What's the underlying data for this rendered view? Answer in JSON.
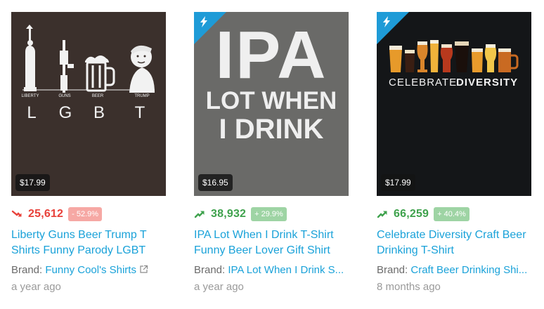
{
  "products": [
    {
      "price": "$17.99",
      "rank": "25,612",
      "change": "- 52.9%",
      "trend": "down",
      "title": "Liberty Guns Beer Trump T Shirts Funny Parody LGBT",
      "brand_label": "Brand:",
      "brand": "Funny Cool's Shirts",
      "age": "a year ago",
      "featured": false,
      "art": {
        "captions": [
          "LIBERTY",
          "GUNS",
          "BEER",
          "TRUMP"
        ],
        "letters": [
          "L",
          "G",
          "B",
          "T"
        ]
      }
    },
    {
      "price": "$16.95",
      "rank": "38,932",
      "change": "+ 29.9%",
      "trend": "up",
      "title": "IPA Lot When I Drink T-Shirt Funny Beer Lover Gift Shirt",
      "brand_label": "Brand:",
      "brand": "IPA Lot When I Drink S...",
      "age": "a year ago",
      "featured": true,
      "art": {
        "line1": "IPA",
        "line2": "LOT WHEN",
        "line3": "I DRINK"
      }
    },
    {
      "price": "$17.99",
      "rank": "66,259",
      "change": "+ 40.4%",
      "trend": "up",
      "title": "Celebrate Diversity Craft Beer Drinking T-Shirt",
      "brand_label": "Brand:",
      "brand": "Craft Beer Drinking Shi...",
      "age": "8 months ago",
      "featured": true,
      "art": {
        "word1": "CELEBRATE",
        "word2": "DIVERSITY"
      }
    }
  ],
  "colors": {
    "link": "#1aa2d9",
    "down": "#e8413a",
    "up": "#3fa24d",
    "featured_corner": "#1e9bd7"
  },
  "icons": {
    "trend_down": "trend-down-arrow-icon",
    "trend_up": "trend-up-arrow-icon",
    "external_link": "external-link-icon",
    "featured": "lightning-bolt-icon"
  }
}
